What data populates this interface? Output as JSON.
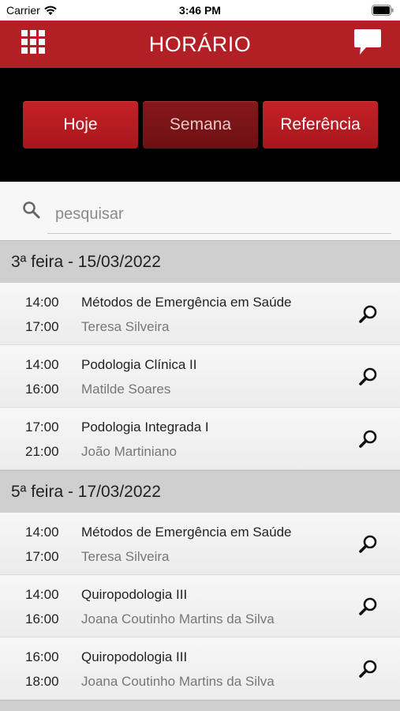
{
  "status_bar": {
    "carrier": "Carrier",
    "time": "3:46 PM"
  },
  "header": {
    "title": "HORÁRIO",
    "menu_icon": "grid-icon",
    "chat_icon": "chat-bubble-icon"
  },
  "segments": {
    "hoje": "Hoje",
    "semana": "Semana",
    "referencia": "Referência",
    "selected": "Semana"
  },
  "search": {
    "placeholder": "pesquisar",
    "value": ""
  },
  "days": [
    {
      "label": "3ª feira - 15/03/2022",
      "events": [
        {
          "start": "14:00",
          "end": "17:00",
          "title": "Métodos de Emergência em Saúde",
          "teacher": "Teresa Silveira"
        },
        {
          "start": "14:00",
          "end": "16:00",
          "title": "Podologia Clínica II",
          "teacher": "Matilde Soares"
        },
        {
          "start": "17:00",
          "end": "21:00",
          "title": "Podologia Integrada I",
          "teacher": "João Martiniano"
        }
      ]
    },
    {
      "label": "5ª feira - 17/03/2022",
      "events": [
        {
          "start": "14:00",
          "end": "17:00",
          "title": "Métodos de Emergência em Saúde",
          "teacher": "Teresa Silveira"
        },
        {
          "start": "14:00",
          "end": "16:00",
          "title": "Quiropodologia III",
          "teacher": "Joana Coutinho Martins da Silva"
        },
        {
          "start": "16:00",
          "end": "18:00",
          "title": "Quiropodologia III",
          "teacher": "Joana Coutinho Martins da Silva"
        }
      ]
    }
  ],
  "colors": {
    "brand": "#b21f24",
    "active_segment": "#7a1417"
  }
}
